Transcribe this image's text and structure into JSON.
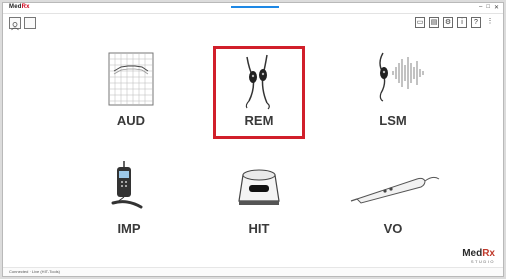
{
  "titlebar": {
    "logo_main": "Med",
    "logo_rx": "Rx",
    "controls": [
      "–",
      "□",
      "✕"
    ]
  },
  "toolbar": {
    "right_icons": [
      "window-icon",
      "audiogram-icon",
      "gear-icon",
      "info-icon",
      "help-icon",
      "more-icon"
    ]
  },
  "modules": [
    {
      "label": "AUD",
      "icon": "audiogram-icon"
    },
    {
      "label": "REM",
      "icon": "rem-probe-icon",
      "selected": true
    },
    {
      "label": "LSM",
      "icon": "lsm-speech-icon"
    },
    {
      "label": "IMP",
      "icon": "impedance-device-icon"
    },
    {
      "label": "HIT",
      "icon": "hit-box-icon"
    },
    {
      "label": "VO",
      "icon": "video-otoscope-icon"
    }
  ],
  "brand": {
    "main": "Med",
    "rx": "Rx",
    "sub": "STUDIO"
  },
  "status": {
    "text": "Connected · Live (HIT-Tools)"
  },
  "colors": {
    "selection": "#d11f2a",
    "accent": "#1e88e5"
  }
}
